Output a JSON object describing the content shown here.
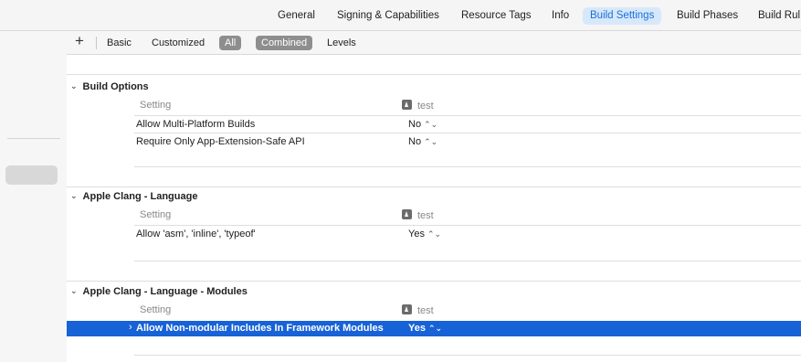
{
  "tabs": [
    {
      "label": "General",
      "active": false
    },
    {
      "label": "Signing & Capabilities",
      "active": false
    },
    {
      "label": "Resource Tags",
      "active": false
    },
    {
      "label": "Info",
      "active": false
    },
    {
      "label": "Build Settings",
      "active": true
    },
    {
      "label": "Build Phases",
      "active": false
    },
    {
      "label": "Build Rul",
      "active": false
    }
  ],
  "filter_bar": {
    "add": "+",
    "basic": "Basic",
    "customized": "Customized",
    "all": "All",
    "combined": "Combined",
    "levels": "Levels"
  },
  "columns": {
    "setting": "Setting",
    "target": "test"
  },
  "sections": [
    {
      "title": "Build Options",
      "rows": [
        {
          "setting": "Allow Multi-Platform Builds",
          "value": "No"
        },
        {
          "setting": "Require Only App-Extension-Safe API",
          "value": "No"
        }
      ]
    },
    {
      "title": "Apple Clang - Language",
      "rows": [
        {
          "setting": "Allow 'asm', 'inline', 'typeof'",
          "value": "Yes"
        }
      ]
    },
    {
      "title": "Apple Clang - Language - Modules",
      "rows": [
        {
          "setting": "Allow Non-modular Includes In Framework Modules",
          "value": "Yes",
          "selected": true
        }
      ]
    }
  ],
  "icons": {
    "chevron_down": "⌄",
    "chevron_right": "›",
    "stepper": "⌃⌄"
  },
  "colors": {
    "accent": "#1762d6",
    "active_tab_bg": "#d7e8fb",
    "active_tab_text": "#1a6fd8"
  }
}
